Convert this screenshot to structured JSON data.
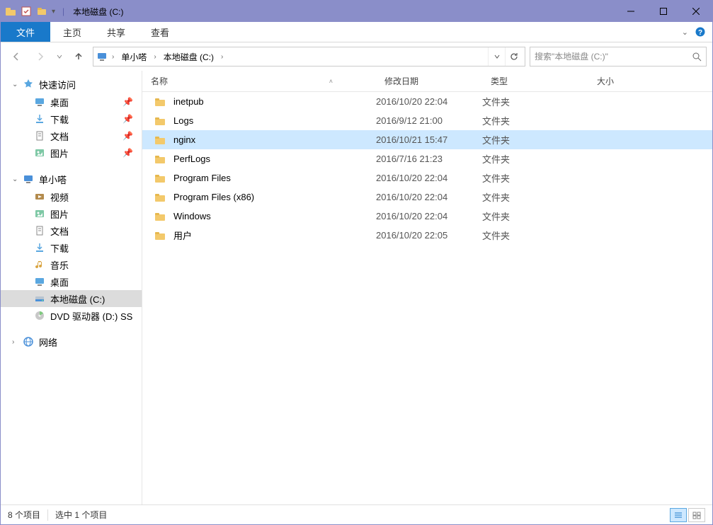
{
  "window": {
    "title": "本地磁盘 (C:)"
  },
  "ribbon": {
    "file": "文件",
    "tabs": [
      "主页",
      "共享",
      "查看"
    ]
  },
  "nav": {
    "breadcrumb": [
      "单小嗒",
      "本地磁盘 (C:)"
    ],
    "search_placeholder": "搜索\"本地磁盘 (C:)\""
  },
  "sidebar": {
    "quick_access": "快速访问",
    "quick_items": [
      {
        "label": "桌面",
        "icon": "desktop",
        "pinned": true
      },
      {
        "label": "下载",
        "icon": "download",
        "pinned": true
      },
      {
        "label": "文档",
        "icon": "doc",
        "pinned": true
      },
      {
        "label": "图片",
        "icon": "pic",
        "pinned": true
      }
    ],
    "user_root": "单小嗒",
    "user_items": [
      {
        "label": "视频",
        "icon": "video"
      },
      {
        "label": "图片",
        "icon": "pic"
      },
      {
        "label": "文档",
        "icon": "doc"
      },
      {
        "label": "下载",
        "icon": "download"
      },
      {
        "label": "音乐",
        "icon": "music"
      },
      {
        "label": "桌面",
        "icon": "desktop"
      },
      {
        "label": "本地磁盘 (C:)",
        "icon": "drive",
        "selected": true
      },
      {
        "label": "DVD 驱动器 (D:) SS",
        "icon": "dvd"
      }
    ],
    "network": "网络"
  },
  "columns": {
    "name": "名称",
    "date": "修改日期",
    "type": "类型",
    "size": "大小"
  },
  "files": [
    {
      "name": "inetpub",
      "date": "2016/10/20 22:04",
      "type": "文件夹"
    },
    {
      "name": "Logs",
      "date": "2016/9/12 21:00",
      "type": "文件夹"
    },
    {
      "name": "nginx",
      "date": "2016/10/21 15:47",
      "type": "文件夹",
      "selected": true
    },
    {
      "name": "PerfLogs",
      "date": "2016/7/16 21:23",
      "type": "文件夹"
    },
    {
      "name": "Program Files",
      "date": "2016/10/20 22:04",
      "type": "文件夹"
    },
    {
      "name": "Program Files (x86)",
      "date": "2016/10/20 22:04",
      "type": "文件夹"
    },
    {
      "name": "Windows",
      "date": "2016/10/20 22:04",
      "type": "文件夹"
    },
    {
      "name": "用户",
      "date": "2016/10/20 22:05",
      "type": "文件夹"
    }
  ],
  "status": {
    "item_count": "8 个项目",
    "selected": "选中 1 个项目"
  }
}
